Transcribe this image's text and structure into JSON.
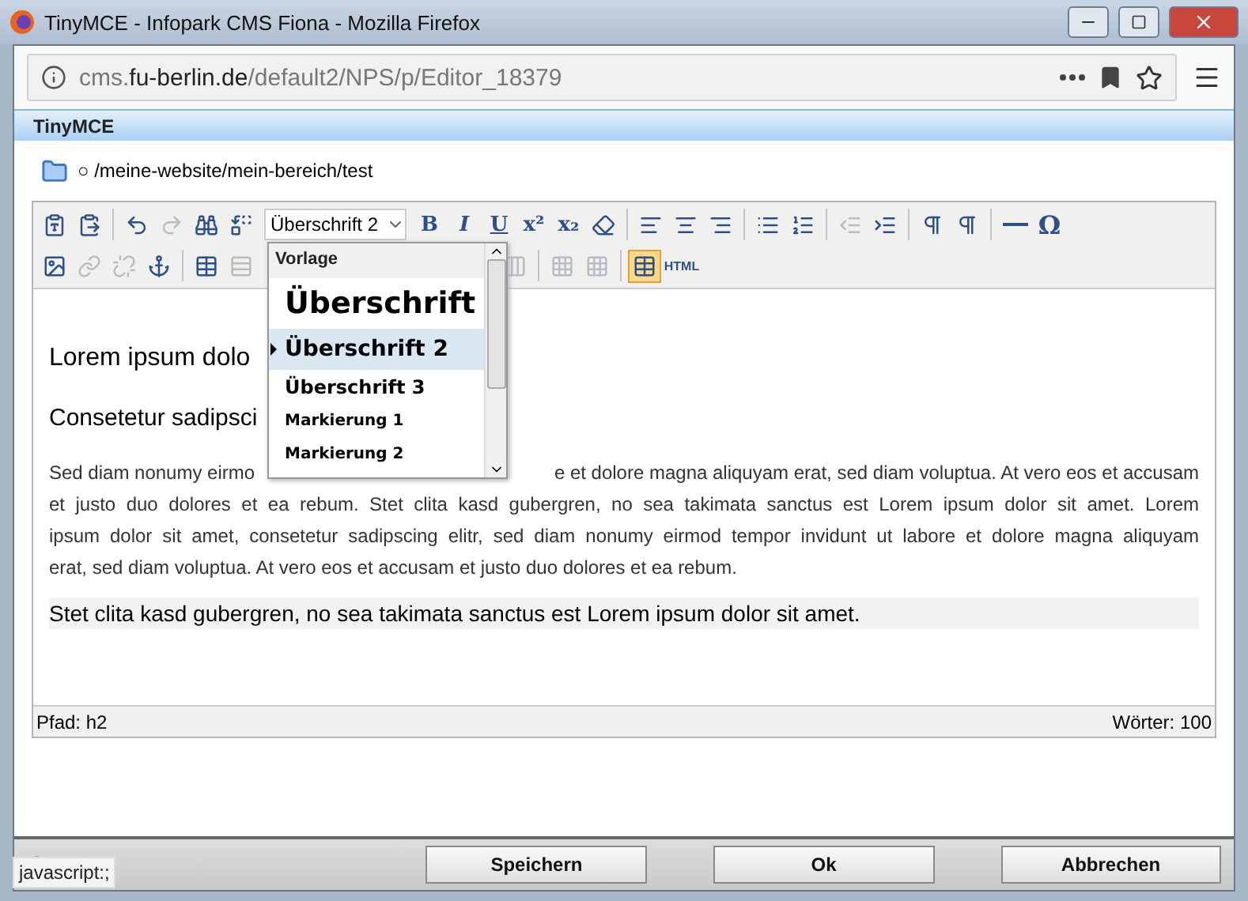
{
  "window": {
    "title": "TinyMCE - Infopark CMS Fiona - Mozilla Firefox"
  },
  "address_bar": {
    "host_prefix": "cms.",
    "host": "fu-berlin.de",
    "path": "/default2/NPS/p/Editor_18379"
  },
  "dialog": {
    "title": "TinyMCE",
    "path_marker": "○",
    "path": "/meine-website/mein-bereich/test"
  },
  "toolbar": {
    "row_1": [
      {
        "kind": "icon",
        "disabled": false
      },
      {
        "kind": "icon",
        "disabled": false
      },
      {
        "kind": "sep"
      },
      {
        "kind": "icon",
        "disabled": false
      },
      {
        "kind": "icon",
        "disabled": true
      },
      {
        "kind": "icon",
        "disabled": false
      },
      {
        "kind": "icon",
        "disabled": false
      },
      {
        "kind": "select",
        "label": "Überschrift 2"
      },
      {
        "kind": "bold",
        "label": "B"
      },
      {
        "kind": "italic",
        "label": "I"
      },
      {
        "kind": "underline",
        "label": "U"
      },
      {
        "kind": "bold",
        "label": "x²"
      },
      {
        "kind": "bold",
        "label": "x₂"
      },
      {
        "kind": "icon",
        "disabled": false
      },
      {
        "kind": "sep"
      },
      {
        "kind": "icon",
        "disabled": false
      },
      {
        "kind": "icon",
        "disabled": false
      },
      {
        "kind": "icon",
        "disabled": false
      },
      {
        "kind": "sep"
      },
      {
        "kind": "icon",
        "disabled": false
      },
      {
        "kind": "icon",
        "disabled": false
      },
      {
        "kind": "sep"
      },
      {
        "kind": "icon",
        "disabled": true
      },
      {
        "kind": "icon",
        "disabled": false
      },
      {
        "kind": "sep"
      },
      {
        "kind": "icon",
        "disabled": false
      },
      {
        "kind": "icon",
        "disabled": false
      },
      {
        "kind": "sep"
      },
      {
        "kind": "icon",
        "disabled": false
      },
      {
        "kind": "symbol",
        "label": "Ω"
      }
    ],
    "row_2": [
      {
        "kind": "icon",
        "disabled": false
      },
      {
        "kind": "icon",
        "disabled": true
      },
      {
        "kind": "icon",
        "disabled": true
      },
      {
        "kind": "icon",
        "disabled": false
      },
      {
        "kind": "sep"
      },
      {
        "kind": "icon",
        "disabled": false,
        "selected": false
      },
      {
        "kind": "icon",
        "disabled": true,
        "selected": false
      },
      {
        "kind": "gap"
      },
      {
        "kind": "icon",
        "disabled": true,
        "selected": false
      },
      {
        "kind": "sep"
      },
      {
        "kind": "icon",
        "disabled": true,
        "selected": false
      },
      {
        "kind": "icon",
        "disabled": true,
        "selected": false
      },
      {
        "kind": "sep"
      },
      {
        "kind": "icon",
        "disabled": false,
        "selected": true
      },
      {
        "kind": "html",
        "label": "HTML"
      }
    ]
  },
  "format_menu": {
    "title": "Vorlage",
    "items": [
      {
        "label": "Überschrift",
        "kind": "h1",
        "selected": false
      },
      {
        "label": "Überschrift 2",
        "kind": "h2",
        "selected": true
      },
      {
        "label": "Überschrift 3",
        "kind": "h3",
        "selected": false
      },
      {
        "label": "Markierung 1",
        "kind": "mark",
        "selected": false
      },
      {
        "label": "Markierung 2",
        "kind": "mark",
        "selected": false
      }
    ]
  },
  "content": {
    "heading_2": "Lorem ipsum dolo",
    "heading_3": "Consetetur sadipsci",
    "paragraph_lines": [
      {
        "left": "Sed diam nonumy eirmo",
        "right": "e et dolore magna aliquyam erat, sed diam voluptua. At vero eos et accusam"
      },
      {
        "left": "et justo duo dolores et ea rebum. Stet clita kasd gubergren, no sea takimata sanctus est Lorem ipsum dolor sit amet. Lorem"
      },
      {
        "left": "ipsum dolor sit amet, consetetur sadipscing elitr, sed diam nonumy eirmod tempor invidunt ut labore et dolore magna aliquyam"
      },
      {
        "left": "erat, sed diam voluptua. At vero eos et accusam et justo duo dolores et ea rebum.",
        "last": true
      }
    ],
    "current_line": "Stet clita kasd gubergren, no sea takimata sanctus est Lorem ipsum dolor sit amet."
  },
  "status_bar": {
    "path": "Pfad: h2",
    "words": "Wörter: 100"
  },
  "buttons": [
    "Speichern",
    "Ok",
    "Abbrechen"
  ],
  "link_status": "javascript:;"
}
